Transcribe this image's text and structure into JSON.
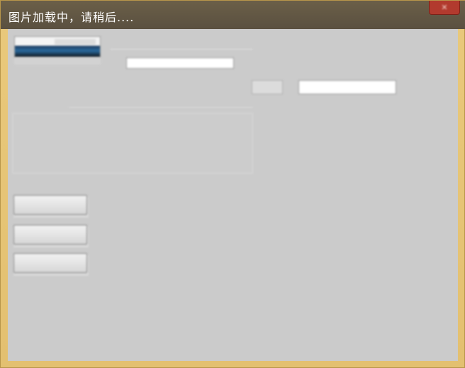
{
  "overlay": {
    "loading_text": "图片加载中，请稍后...."
  },
  "window": {
    "title": "",
    "close_symbol": "✕"
  },
  "logo": {
    "text": ""
  },
  "frequency": {
    "label": "",
    "prefix": "",
    "value": "",
    "unit": ""
  },
  "ptt": {
    "label": "",
    "prefix": "",
    "value": ""
  },
  "status": {
    "label": "",
    "content": ""
  },
  "buttons": {
    "button1_label": "",
    "button2_label": "",
    "button3_label": ""
  },
  "colors": {
    "frame": "#e9c97c",
    "client": "#cbcbcb",
    "title_overlay": "#5e5444",
    "close": "#b23a2e"
  }
}
